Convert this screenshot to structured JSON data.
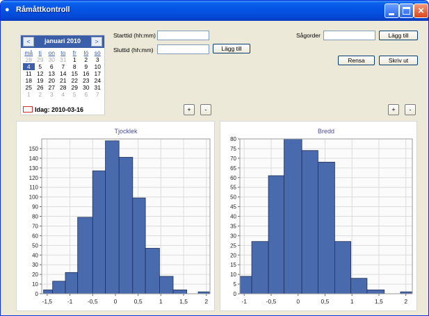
{
  "window": {
    "title": "Råmåttkontroll",
    "icon": "eye-icon",
    "controls": [
      "minimize-icon",
      "maximize-icon",
      "close-icon"
    ],
    "close_glyph": "×"
  },
  "calendar": {
    "prev": "<",
    "next": ">",
    "month": "januari 2010",
    "weekdays": [
      "må",
      "ti",
      "on",
      "to",
      "fr",
      "lö",
      "sö"
    ],
    "weeks": [
      [
        {
          "d": "28",
          "o": true
        },
        {
          "d": "29",
          "o": true
        },
        {
          "d": "30",
          "o": true
        },
        {
          "d": "31",
          "o": true
        },
        {
          "d": "1"
        },
        {
          "d": "2"
        },
        {
          "d": "3"
        }
      ],
      [
        {
          "d": "4",
          "s": true
        },
        {
          "d": "5"
        },
        {
          "d": "6"
        },
        {
          "d": "7"
        },
        {
          "d": "8"
        },
        {
          "d": "9"
        },
        {
          "d": "10"
        }
      ],
      [
        {
          "d": "11"
        },
        {
          "d": "12"
        },
        {
          "d": "13"
        },
        {
          "d": "14"
        },
        {
          "d": "15"
        },
        {
          "d": "16"
        },
        {
          "d": "17"
        }
      ],
      [
        {
          "d": "18"
        },
        {
          "d": "19"
        },
        {
          "d": "20"
        },
        {
          "d": "21"
        },
        {
          "d": "22"
        },
        {
          "d": "23"
        },
        {
          "d": "24"
        }
      ],
      [
        {
          "d": "25"
        },
        {
          "d": "26"
        },
        {
          "d": "27"
        },
        {
          "d": "28"
        },
        {
          "d": "29"
        },
        {
          "d": "30"
        },
        {
          "d": "31"
        }
      ],
      [
        {
          "d": "1",
          "o": true
        },
        {
          "d": "2",
          "o": true
        },
        {
          "d": "3",
          "o": true
        },
        {
          "d": "4",
          "o": true
        },
        {
          "d": "5",
          "o": true
        },
        {
          "d": "6",
          "o": true
        },
        {
          "d": "7",
          "o": true
        }
      ]
    ],
    "today": "Idag: 2010-03-16"
  },
  "form": {
    "start_label": "Starttid (hh:mm)",
    "start_value": "",
    "end_label": "Sluttid (hh:mm)",
    "end_value": "",
    "add_label": "Lägg till",
    "order_label": "Sågorder",
    "order_value": "",
    "order_add_label": "Lägg till",
    "clear_label": "Rensa",
    "print_label": "Skriv ut",
    "plus": "+",
    "minus": "-"
  },
  "colors": {
    "bar": "#4a6aae",
    "title": "#4a4a9a",
    "grid": "#dcdcdc"
  },
  "chart_data": [
    {
      "type": "bar",
      "title": "Tjocklek",
      "bin_edges": [
        -1.75,
        -1.5,
        -1.25,
        -1,
        -0.75,
        -0.5,
        -0.25,
        0,
        0.25,
        0.5,
        0.75,
        1,
        1.25,
        1.5,
        1.75,
        2,
        2.25
      ],
      "values": [
        4,
        13,
        22,
        0,
        79,
        127,
        158,
        141,
        99,
        47,
        18,
        4,
        0,
        2
      ],
      "bars": [
        {
          "x0": -1.58,
          "x1": -1.38,
          "v": 4
        },
        {
          "x0": -1.38,
          "x1": -1.1,
          "v": 13
        },
        {
          "x0": -1.1,
          "x1": -0.83,
          "v": 22
        },
        {
          "x0": -0.83,
          "x1": -0.5,
          "v": 79
        },
        {
          "x0": -0.5,
          "x1": -0.22,
          "v": 127
        },
        {
          "x0": -0.22,
          "x1": 0.08,
          "v": 158
        },
        {
          "x0": 0.08,
          "x1": 0.38,
          "v": 141
        },
        {
          "x0": 0.38,
          "x1": 0.66,
          "v": 99
        },
        {
          "x0": 0.66,
          "x1": 0.97,
          "v": 47
        },
        {
          "x0": 0.97,
          "x1": 1.27,
          "v": 18
        },
        {
          "x0": 1.27,
          "x1": 1.57,
          "v": 4
        },
        {
          "x0": 1.82,
          "x1": 2.08,
          "v": 2
        }
      ],
      "xlim": [
        -1.62,
        2.08
      ],
      "ylim": [
        0,
        160
      ],
      "xticks": [
        -1.5,
        -1,
        -0.5,
        0,
        0.5,
        1,
        1.5,
        2
      ],
      "xtick_labels": [
        "-1,5",
        "-1",
        "-0,5",
        "0",
        "0,5",
        "1",
        "1,5",
        "2"
      ],
      "yticks": [
        0,
        10,
        20,
        30,
        40,
        50,
        60,
        70,
        80,
        90,
        100,
        110,
        120,
        130,
        140,
        150
      ],
      "grid": true
    },
    {
      "type": "bar",
      "title": "Bredd",
      "bars": [
        {
          "x0": -1.08,
          "x1": -0.86,
          "v": 9
        },
        {
          "x0": -0.86,
          "x1": -0.55,
          "v": 27
        },
        {
          "x0": -0.55,
          "x1": -0.26,
          "v": 61
        },
        {
          "x0": -0.26,
          "x1": 0.07,
          "v": 80
        },
        {
          "x0": 0.07,
          "x1": 0.37,
          "v": 74
        },
        {
          "x0": 0.37,
          "x1": 0.68,
          "v": 68
        },
        {
          "x0": 0.68,
          "x1": 0.98,
          "v": 27
        },
        {
          "x0": 0.98,
          "x1": 1.28,
          "v": 8
        },
        {
          "x0": 1.28,
          "x1": 1.6,
          "v": 2
        },
        {
          "x0": 1.9,
          "x1": 2.12,
          "v": 1
        }
      ],
      "xlim": [
        -1.08,
        2.12
      ],
      "ylim": [
        0,
        80
      ],
      "xticks": [
        -1,
        -0.5,
        0,
        0.5,
        1,
        1.5,
        2
      ],
      "xtick_labels": [
        "-1",
        "-0,5",
        "0",
        "0,5",
        "1",
        "1,5",
        "2"
      ],
      "yticks": [
        0,
        5,
        10,
        15,
        20,
        25,
        30,
        35,
        40,
        45,
        50,
        55,
        60,
        65,
        70,
        75,
        80
      ],
      "grid": true
    }
  ]
}
